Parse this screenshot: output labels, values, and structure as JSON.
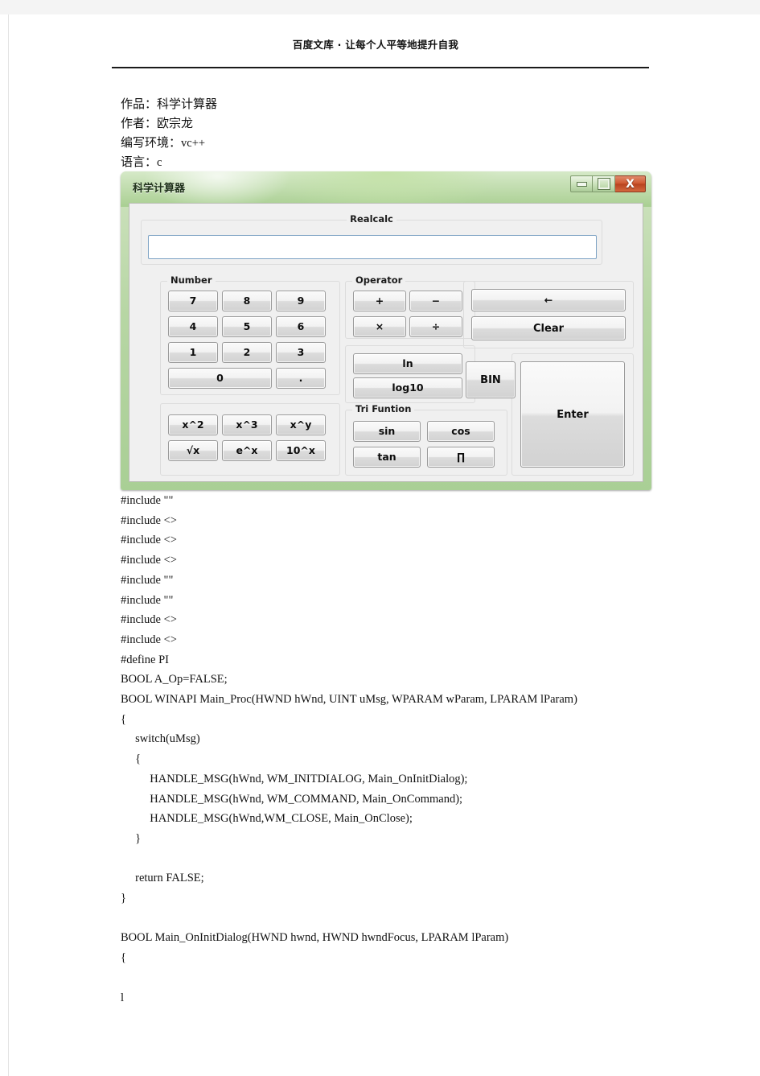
{
  "page": {
    "header_text": "百度文库 · 让每个人平等地提升自我"
  },
  "meta": [
    {
      "label": "作品：",
      "value": "科学计算器",
      "value_latin": false
    },
    {
      "label": "作者：",
      "value": "欧宗龙",
      "value_latin": false
    },
    {
      "label": "编写环境：",
      "value": "vc++",
      "value_latin": true
    },
    {
      "label": "语言：",
      "value": "c",
      "value_latin": true
    }
  ],
  "calculator": {
    "window_title": "科学计算器",
    "window_buttons": {
      "minimize": "minimize-icon",
      "maximize": "maximize-icon",
      "close": "X"
    },
    "display": {
      "group_label": "Realcalc",
      "value": "",
      "placeholder": ""
    },
    "groups": {
      "number_label": "Number",
      "operator_label": "Operator",
      "tri_label": "Tri Funtion"
    },
    "number_buttons": [
      "7",
      "8",
      "9",
      "4",
      "5",
      "6",
      "1",
      "2",
      "3",
      "0",
      "."
    ],
    "operator_buttons": [
      "+",
      "−",
      "×",
      "÷"
    ],
    "log_buttons": [
      "ln",
      "log10"
    ],
    "tri_buttons": [
      "sin",
      "cos",
      "tan",
      "∏"
    ],
    "power_buttons": [
      "x^2",
      "x^3",
      "x^y",
      "√x",
      "e^x",
      "10^x"
    ],
    "edit_buttons": {
      "backspace": "←",
      "clear": "Clear",
      "bin": "BIN",
      "enter": "Enter"
    },
    "colors": {
      "frame": "#a9cf95",
      "client": "#f0f0f0",
      "close_button": "#cf5a32",
      "display_border": "#7da2c4"
    }
  },
  "code_lines": [
    "#include \"\"",
    "#include <>",
    "#include <>",
    "#include <>",
    "#include \"\"",
    "#include \"\"",
    "#include <>",
    "#include <>",
    "#define PI",
    "BOOL A_Op=FALSE;",
    "BOOL WINAPI Main_Proc(HWND hWnd, UINT uMsg, WPARAM wParam, LPARAM lParam)",
    "{",
    "     switch(uMsg)",
    "     {",
    "          HANDLE_MSG(hWnd, WM_INITDIALOG, Main_OnInitDialog);",
    "          HANDLE_MSG(hWnd, WM_COMMAND, Main_OnCommand);",
    "          HANDLE_MSG(hWnd,WM_CLOSE, Main_OnClose);",
    "     }",
    "",
    "     return FALSE;",
    "}",
    "",
    "BOOL Main_OnInitDialog(HWND hwnd, HWND hwndFocus, LPARAM lParam)",
    "{",
    "",
    "l"
  ]
}
